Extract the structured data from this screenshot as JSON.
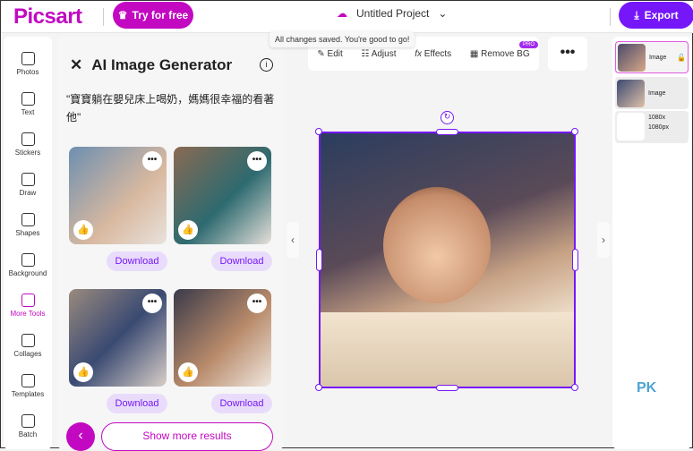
{
  "header": {
    "logo": "Picsart",
    "try_label": "Try for free",
    "project_title": "Untitled Project",
    "export_label": "Export",
    "tooltip": "All changes saved. You're good to go!"
  },
  "rail": [
    {
      "label": "Photos"
    },
    {
      "label": "Text"
    },
    {
      "label": "Stickers"
    },
    {
      "label": "Draw"
    },
    {
      "label": "Shapes"
    },
    {
      "label": "Background"
    },
    {
      "label": "More Tools",
      "active": true
    },
    {
      "label": "Collages"
    },
    {
      "label": "Templates"
    },
    {
      "label": "Batch"
    }
  ],
  "panel": {
    "title": "AI Image Generator",
    "prompt": "\"寶寶躺在嬰兒床上喝奶，媽媽很幸福的看著他\"",
    "download_label": "Download",
    "more": "•••",
    "show_more": "Show more results",
    "back": "‹"
  },
  "toolbar": {
    "edit": "Edit",
    "adjust": "Adjust",
    "effects": "Effects",
    "remove_bg": "Remove BG",
    "pro_badge": "PRO",
    "more": "•••"
  },
  "layers": [
    {
      "label": "Image"
    },
    {
      "label": "Image"
    },
    {
      "label": "1080x 1080px"
    }
  ],
  "watermark": "PK",
  "colors": {
    "brand": "#c209c1",
    "accent": "#7517f8"
  }
}
